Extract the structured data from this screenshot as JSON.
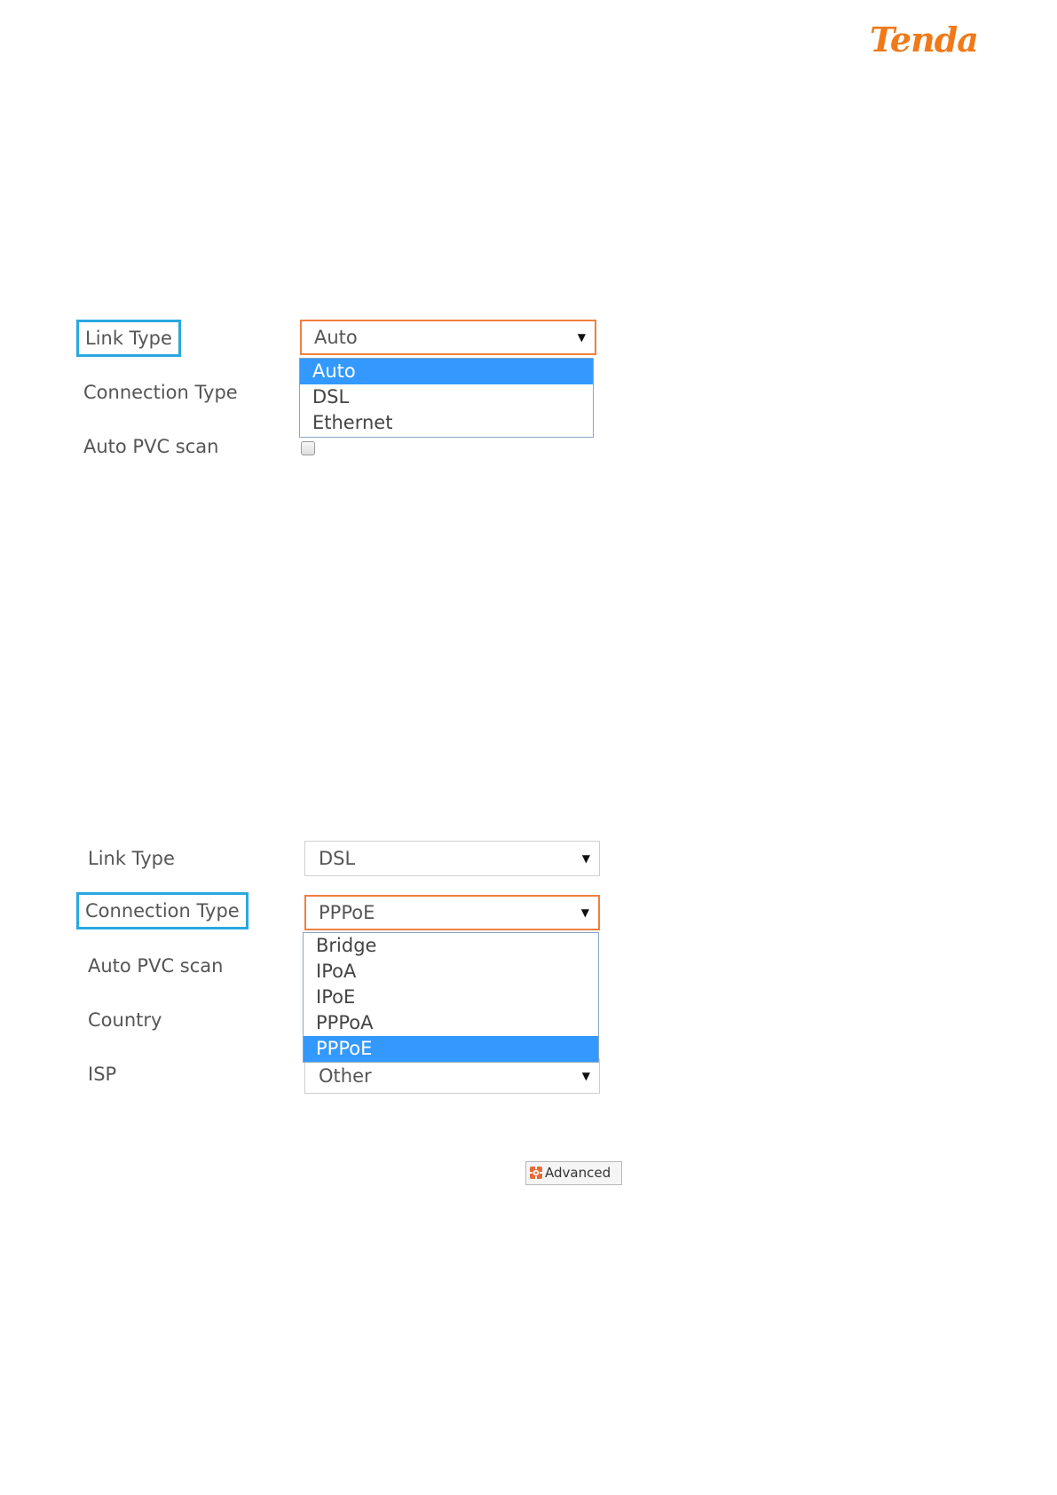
{
  "brand": {
    "logo_text": "Tenda",
    "color": "#f07a1a"
  },
  "section1": {
    "link_type_label": "Link Type",
    "connection_type_label": "Connection Type",
    "auto_pvc_label": "Auto PVC scan",
    "link_type_value": "Auto",
    "link_type_options": [
      "Auto",
      "DSL",
      "Ethernet"
    ],
    "link_type_selected_index": 0,
    "auto_pvc_checked": false
  },
  "section2": {
    "link_type_label": "Link Type",
    "connection_type_label": "Connection Type",
    "auto_pvc_label": "Auto PVC scan",
    "country_label": "Country",
    "isp_label": "ISP",
    "link_type_value": "DSL",
    "connection_type_value": "PPPoE",
    "connection_type_options": [
      "Bridge",
      "IPoA",
      "IPoE",
      "PPPoA",
      "PPPoE"
    ],
    "connection_type_selected_index": 4,
    "isp_value": "Other"
  },
  "advanced_button": {
    "label": "Advanced",
    "icon": "gear-icon"
  },
  "colors": {
    "highlight_box": "#29a8e0",
    "focus_border": "#f08040",
    "selected_option": "#3399ff"
  }
}
